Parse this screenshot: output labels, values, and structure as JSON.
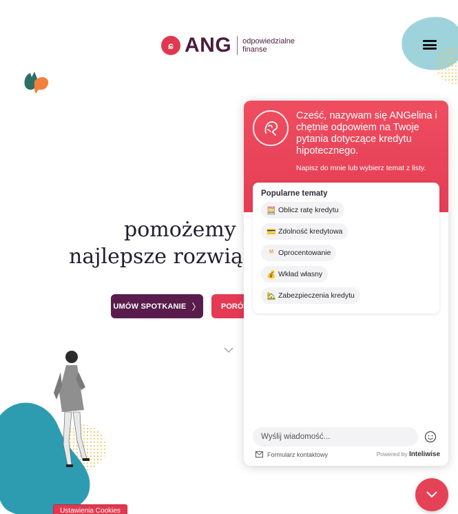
{
  "header": {
    "brand": "ANG",
    "tagline_1": "odpowiedzialne",
    "tagline_2": "finanse"
  },
  "hero": {
    "line_1": "pomożemy C",
    "line_2": "najlepsze rozwiąza",
    "cta_meeting": "UMÓW SPOTKANIE",
    "cta_compare": "PORÓW"
  },
  "cookies": {
    "label": "Ustawienia Cookies"
  },
  "chat": {
    "greeting": "Cześć, nazywam się ANGelina i chętnie odpowiem na Twoje pytania dotyczące kredytu hipotecznego.",
    "hint": "Napisz do mnie lub wybierz temat z listy.",
    "topics_title": "Popularne tematy",
    "topics": [
      {
        "icon": "abacus-icon",
        "label": "Oblicz ratę kredytu"
      },
      {
        "icon": "credit-card-icon",
        "label": "Zdolność kredytowa"
      },
      {
        "icon": "percent-icon",
        "label": "Oprocentowanie"
      },
      {
        "icon": "money-bag-icon",
        "label": "Wkład własny"
      },
      {
        "icon": "house-icon",
        "label": "Zabezpieczenia kredytu"
      }
    ],
    "input_placeholder": "Wyślij wiadomość...",
    "contact_form": "Formularz kontaktowy",
    "powered_by": "Powered by",
    "powered_brand": "Inteliwise"
  },
  "colors": {
    "brand_red": "#e43d55",
    "brand_plum": "#5a1c4c",
    "teal_blob": "#2fa0b0"
  }
}
